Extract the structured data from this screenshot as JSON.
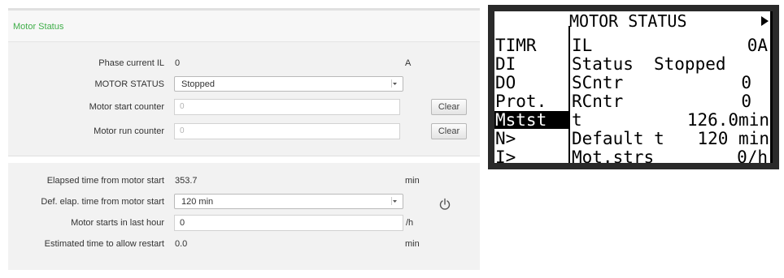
{
  "panel": {
    "title": "Motor Status",
    "rows": {
      "phase_current": {
        "label": "Phase current IL",
        "value": "0",
        "unit": "A"
      },
      "motor_status": {
        "label": "MOTOR STATUS",
        "value": "Stopped"
      },
      "start_counter": {
        "label": "Motor start counter",
        "value": "0",
        "button": "Clear"
      },
      "run_counter": {
        "label": "Motor run counter",
        "value": "0",
        "button": "Clear"
      },
      "elapsed": {
        "label": "Elapsed time from motor start",
        "value": "353.7",
        "unit": "min"
      },
      "def_elapsed": {
        "label": "Def. elap. time from motor start",
        "value": "120 min"
      },
      "starts_last_hour": {
        "label": "Motor starts in last hour",
        "value": "0",
        "unit": "/h"
      },
      "est_restart": {
        "label": "Estimated time to allow restart",
        "value": "0.0",
        "unit": "min"
      }
    },
    "icons": {
      "dropdown": "caret-down-icon",
      "reset": "power-icon"
    },
    "colors": {
      "title": "#3fae49",
      "section_bg": "#f2f2f2"
    }
  },
  "lcd": {
    "title": "MOTOR STATUS",
    "menu": [
      "TIMR",
      "DI",
      "DO",
      "Prot.",
      "Mstst",
      "N>",
      "I>"
    ],
    "selected_menu": "Mstst",
    "lines": [
      {
        "name": "IL",
        "value": "0A"
      },
      {
        "name": "Status",
        "value": "Stopped"
      },
      {
        "name": "SCntr",
        "value": "0"
      },
      {
        "name": "RCntr",
        "value": "0"
      },
      {
        "name": "t",
        "value": "126.0min"
      },
      {
        "name": "Default t",
        "value": "120 min"
      },
      {
        "name": "Mot.strs",
        "value": "0/h"
      }
    ],
    "colors": {
      "bezel": "#2a2a2a",
      "screen": "#ffffff",
      "text": "#000000"
    }
  }
}
